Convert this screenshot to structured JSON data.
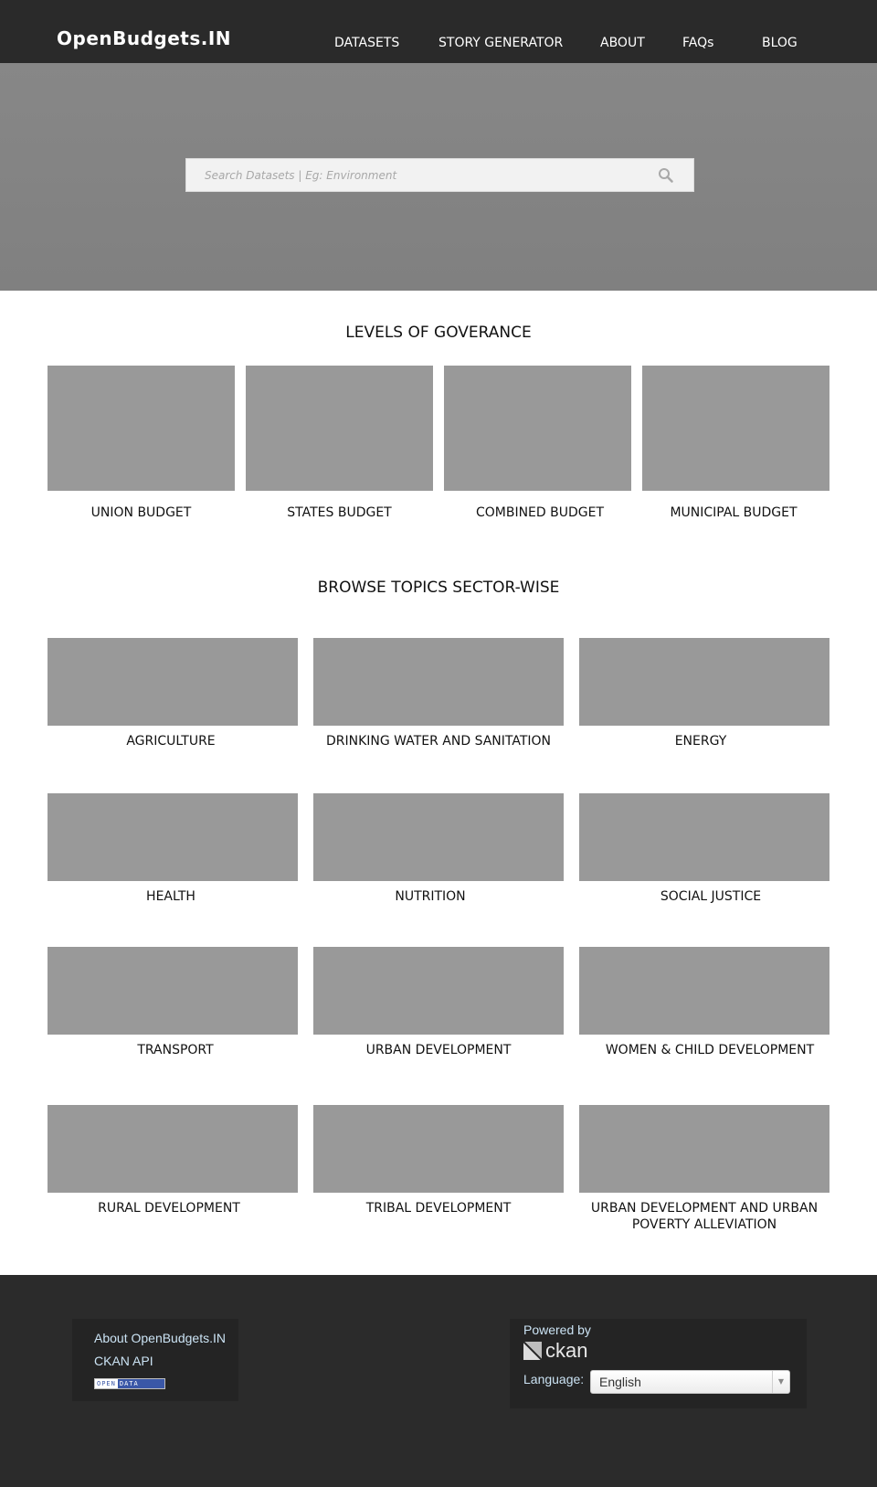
{
  "header": {
    "logo": "OpenBudgets.IN",
    "nav": [
      {
        "label": "DATASETS"
      },
      {
        "label": "STORY GENERATOR"
      },
      {
        "label": "ABOUT"
      },
      {
        "label": "FAQs"
      },
      {
        "label": "BLOG"
      }
    ]
  },
  "hero": {
    "search": {
      "placeholder": "Search Datasets | Eg: Environment",
      "value": "",
      "icon": "search-icon"
    }
  },
  "governance": {
    "title": "LEVELS OF GOVERANCE",
    "items": [
      {
        "label": "UNION BUDGET"
      },
      {
        "label": "STATES BUDGET"
      },
      {
        "label": "COMBINED BUDGET"
      },
      {
        "label": "MUNICIPAL BUDGET"
      }
    ]
  },
  "topics": {
    "title": "BROWSE TOPICS SECTOR-WISE",
    "items": [
      {
        "label": "AGRICULTURE"
      },
      {
        "label": "DRINKING WATER AND SANITATION"
      },
      {
        "label": "ENERGY"
      },
      {
        "label": "HEALTH"
      },
      {
        "label": "NUTRITION"
      },
      {
        "label": "SOCIAL JUSTICE"
      },
      {
        "label": "TRANSPORT"
      },
      {
        "label": "URBAN DEVELOPMENT"
      },
      {
        "label": "WOMEN & CHILD DEVELOPMENT"
      },
      {
        "label": "RURAL DEVELOPMENT"
      },
      {
        "label": "TRIBAL DEVELOPMENT"
      },
      {
        "label": "URBAN DEVELOPMENT AND URBAN POVERTY ALLEVIATION"
      }
    ]
  },
  "footer": {
    "links": [
      {
        "label": "About OpenBudgets.IN"
      },
      {
        "label": "CKAN API"
      }
    ],
    "badge": {
      "open": "OPEN",
      "data": "DATA"
    },
    "powered_by": "Powered by",
    "ckan": "ckan",
    "language_label": "Language:",
    "language_value": "English"
  },
  "colors": {
    "header_bg": "#2a2a2a",
    "hero_bg": "#848484",
    "tile_placeholder": "#999999",
    "footer_bg": "#2b2b2b",
    "footer_link": "#cbe3f4"
  }
}
